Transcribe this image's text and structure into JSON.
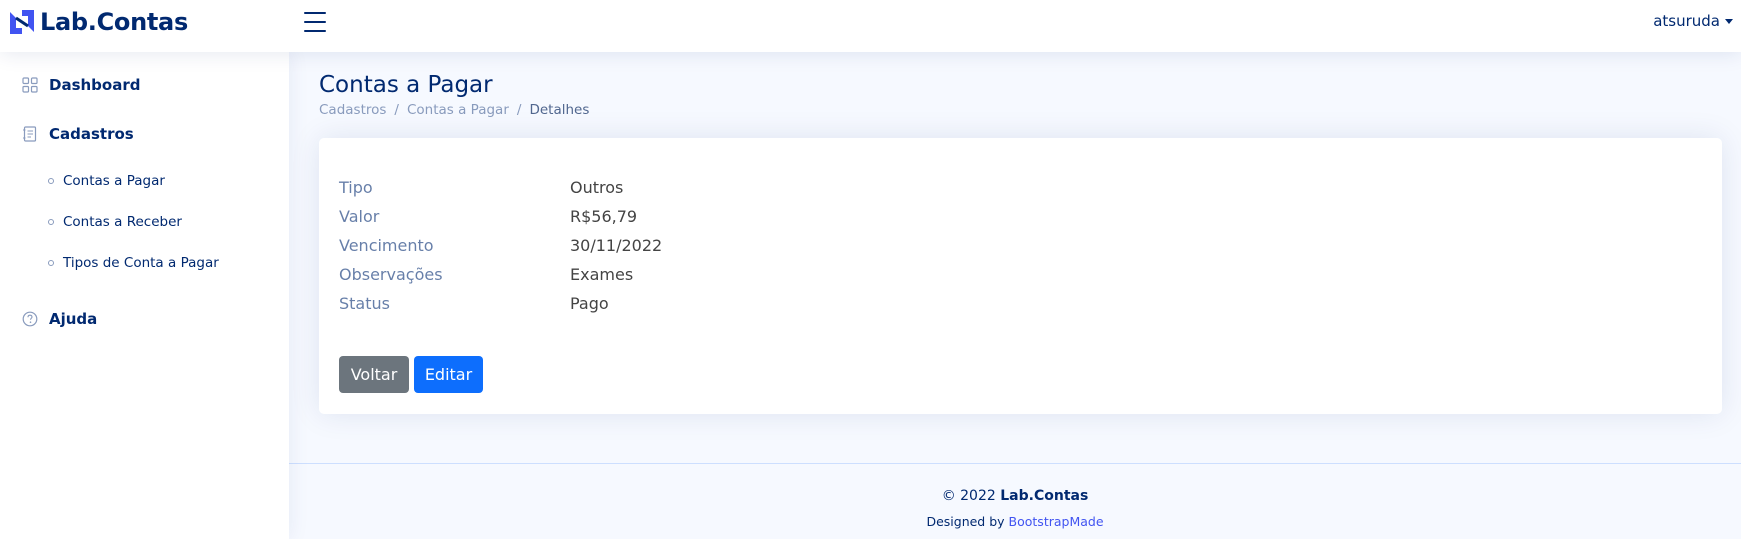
{
  "header": {
    "logo_text": "Lab.Contas",
    "user_name": "atsuruda"
  },
  "sidebar": {
    "items": [
      {
        "label": "Dashboard",
        "icon": "grid-icon"
      },
      {
        "label": "Cadastros",
        "icon": "journal-text-icon"
      },
      {
        "label": "Ajuda",
        "icon": "question-circle-icon"
      }
    ],
    "subitems": [
      {
        "label": "Contas a Pagar"
      },
      {
        "label": "Contas a Receber"
      },
      {
        "label": "Tipos de Conta a Pagar"
      }
    ]
  },
  "page": {
    "title": "Contas a Pagar",
    "breadcrumb": [
      "Cadastros",
      "Contas a Pagar",
      "Detalhes"
    ],
    "breadcrumb_separator": "/"
  },
  "details": [
    {
      "label": "Tipo",
      "value": "Outros"
    },
    {
      "label": "Valor",
      "value": "R$56,79"
    },
    {
      "label": "Vencimento",
      "value": "30/11/2022"
    },
    {
      "label": "Observações",
      "value": "Exames"
    },
    {
      "label": "Status",
      "value": "Pago"
    }
  ],
  "buttons": {
    "back_label": "Voltar",
    "edit_label": "Editar"
  },
  "footer": {
    "copyright_prefix": "© 2022",
    "copyright_brand": "Lab.Contas",
    "credits_prefix": "Designed by",
    "credits_link": "BootstrapMade"
  },
  "colors": {
    "brand": "#012970",
    "accent": "#4154f1",
    "primary_button": "#0d6efd",
    "secondary_button": "#6c757d",
    "background": "#f6f9ff"
  }
}
